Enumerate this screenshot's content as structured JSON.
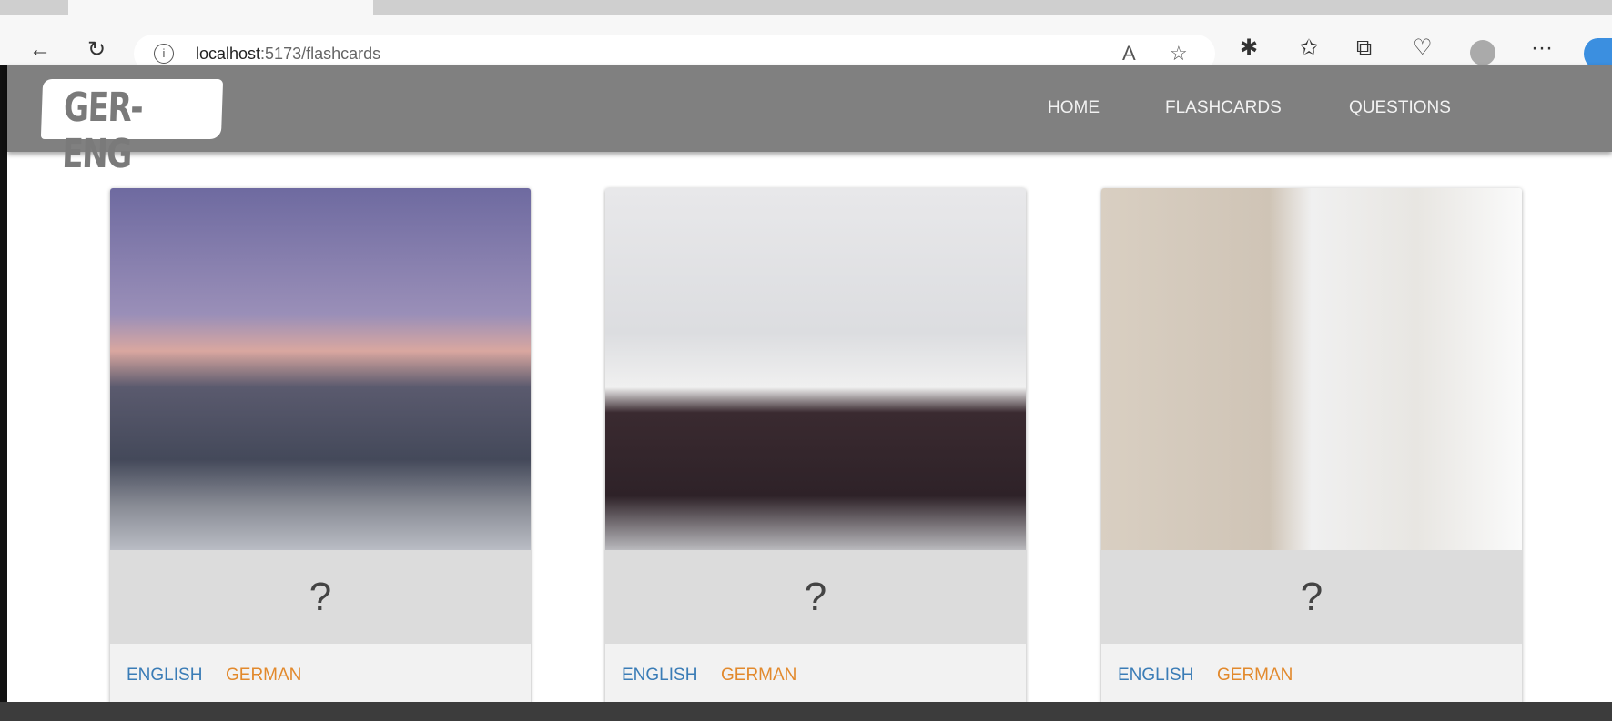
{
  "browser": {
    "url_host": "localhost",
    "url_path": ":5173/flashcards",
    "more_label": "···"
  },
  "nav": {
    "logo": "GER-ENG",
    "links": [
      "HOME",
      "FLASHCARDS",
      "QUESTIONS"
    ]
  },
  "cards": [
    {
      "image": "house",
      "question": "?",
      "english": "ENGLISH",
      "german": "GERMAN"
    },
    {
      "image": "bedroom",
      "question": "?",
      "english": "ENGLISH",
      "german": "GERMAN"
    },
    {
      "image": "bathroom",
      "question": "?",
      "english": "ENGLISH",
      "german": "GERMAN"
    }
  ],
  "colors": {
    "nav": "#808080",
    "english": "#3a7cb6",
    "german": "#e2892c",
    "answer_bg": "#dcdcdc"
  }
}
